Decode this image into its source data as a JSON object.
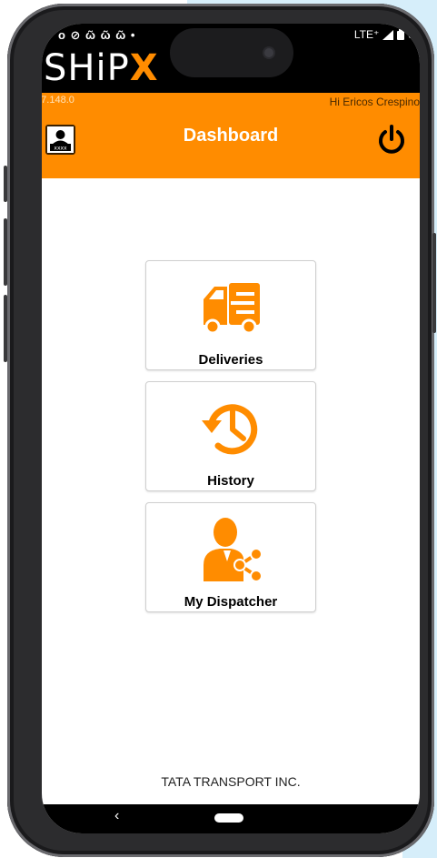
{
  "status_bar": {
    "left_icons": "o ⊘ ῶ ῶ ῶ •",
    "network": "LTE⁺",
    "battery": "5"
  },
  "app": {
    "logo_main": "SHiP",
    "logo_accent": "X",
    "version": ".27.148.0",
    "greeting": "Hi Ericos Crespino",
    "title": "Dashboard"
  },
  "tiles": [
    {
      "label": "Deliveries",
      "icon": "delivery-truck-icon"
    },
    {
      "label": "History",
      "icon": "history-clock-icon"
    },
    {
      "label": "My Dispatcher",
      "icon": "dispatcher-share-icon"
    }
  ],
  "footer": "TATA TRANSPORT INC.",
  "navigation": {
    "back": "‹"
  },
  "colors": {
    "accent": "#FF8C00",
    "background": "#FFFFFF",
    "status_bar": "#000000"
  }
}
